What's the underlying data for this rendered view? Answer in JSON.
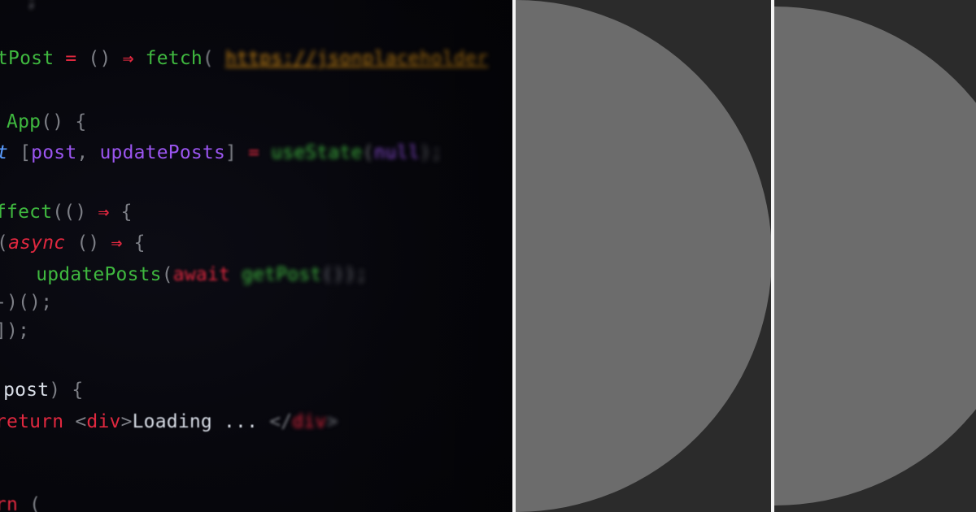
{
  "code_panel": {
    "lines": [
      {
        "tokens": [
          {
            "text": "  ;",
            "cls": "c-gray blur3"
          }
        ]
      },
      {
        "tokens": [
          {
            "text": "tPost",
            "cls": "c-green"
          },
          {
            "text": " = ",
            "cls": "c-red"
          },
          {
            "text": "() ",
            "cls": "c-gray"
          },
          {
            "text": "⇒ ",
            "cls": "c-red bold"
          },
          {
            "text": "fetch",
            "cls": "c-green"
          },
          {
            "text": "( ",
            "cls": "c-gray blur1"
          },
          {
            "text": "https://jsonplaceholder",
            "cls": "c-url blur3"
          }
        ]
      },
      {
        "tokens": [
          {
            "text": " App",
            "cls": "c-green"
          },
          {
            "text": "() {",
            "cls": "c-gray"
          }
        ]
      },
      {
        "tokens": [
          {
            "text": "t",
            "cls": "c-blue ital"
          },
          {
            "text": " [",
            "cls": "c-gray"
          },
          {
            "text": "post",
            "cls": "c-purple"
          },
          {
            "text": ", ",
            "cls": "c-gray"
          },
          {
            "text": "updatePosts",
            "cls": "c-purple"
          },
          {
            "text": "] ",
            "cls": "c-gray blur1"
          },
          {
            "text": "= ",
            "cls": "c-red blur2"
          },
          {
            "text": "useState",
            "cls": "c-green blur3"
          },
          {
            "text": "(",
            "cls": "c-gray blur3"
          },
          {
            "text": "null",
            "cls": "c-purple blur3"
          },
          {
            "text": ");",
            "cls": "c-gray blur4"
          }
        ]
      },
      {
        "tokens": [
          {
            "text": "ffect",
            "cls": "c-green"
          },
          {
            "text": "(() ",
            "cls": "c-gray"
          },
          {
            "text": "⇒ ",
            "cls": "c-red bold"
          },
          {
            "text": "{",
            "cls": "c-gray"
          }
        ]
      },
      {
        "tokens": [
          {
            "text": "(",
            "cls": "c-gray"
          },
          {
            "text": "async",
            "cls": "c-red ital"
          },
          {
            "text": " () ",
            "cls": "c-gray"
          },
          {
            "text": "⇒ ",
            "cls": "c-red bold"
          },
          {
            "text": "{",
            "cls": "c-gray"
          }
        ]
      },
      {
        "tokens": [
          {
            "text": "    updatePosts",
            "cls": "c-green"
          },
          {
            "text": "(",
            "cls": "c-gray"
          },
          {
            "text": "await",
            "cls": "c-red blur2"
          },
          {
            "text": " getPost",
            "cls": "c-green blur3"
          },
          {
            "text": "());",
            "cls": "c-gray blur4"
          }
        ]
      },
      {
        "tokens": [
          {
            "text": "-)();",
            "cls": "c-gray"
          }
        ]
      },
      {
        "tokens": [
          {
            "text": "]);",
            "cls": "c-gray"
          }
        ]
      },
      {
        "tokens": [
          {
            "text": "(",
            "cls": "c-red"
          },
          {
            "text": "post",
            "cls": "c-white"
          },
          {
            "text": ") {",
            "cls": "c-gray"
          }
        ]
      },
      {
        "tokens": [
          {
            "text": "return",
            "cls": "c-red"
          },
          {
            "text": " <",
            "cls": "c-gray"
          },
          {
            "text": "div",
            "cls": "c-red"
          },
          {
            "text": ">",
            "cls": "c-gray"
          },
          {
            "text": "Loading ...",
            "cls": "c-white blur1"
          },
          {
            "text": " </",
            "cls": "c-gray blur2"
          },
          {
            "text": "div",
            "cls": "c-red blur3"
          },
          {
            "text": ">",
            "cls": "c-gray blur3"
          }
        ]
      },
      {
        "tokens": [
          {
            "text": "rn",
            "cls": "c-red blur1"
          },
          {
            "text": " (",
            "cls": "c-gray blur1"
          }
        ]
      }
    ]
  },
  "colors": {
    "background": "#2a2a2a",
    "panel": "#2b2b2b",
    "shape": "#6c6c6c",
    "divider": "#f4f4f4"
  }
}
